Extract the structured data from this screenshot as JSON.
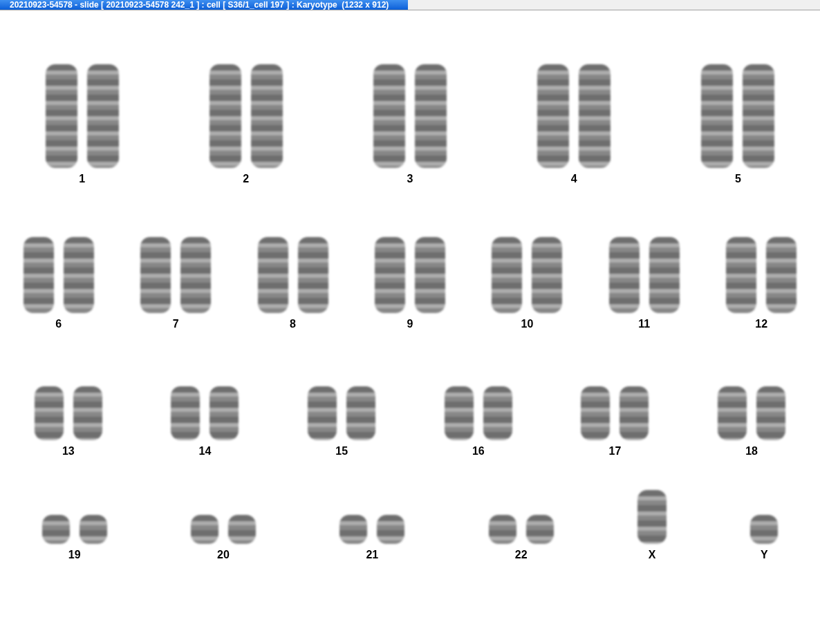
{
  "window": {
    "title": "20210923-54578 - slide [ 20210923-54578 242_1 ] : cell [ S36/1_cell 197 ] : Karyotype  (1232 x 912)"
  },
  "karyotype": {
    "rows": [
      {
        "items": [
          {
            "label": "1",
            "kind": "pair-large"
          },
          {
            "label": "2",
            "kind": "pair-large"
          },
          {
            "label": "3",
            "kind": "pair-large"
          },
          {
            "label": "4",
            "kind": "pair-large"
          },
          {
            "label": "5",
            "kind": "pair-large"
          }
        ]
      },
      {
        "items": [
          {
            "label": "6",
            "kind": "pair-medium"
          },
          {
            "label": "7",
            "kind": "pair-medium"
          },
          {
            "label": "8",
            "kind": "pair-medium"
          },
          {
            "label": "9",
            "kind": "pair-medium"
          },
          {
            "label": "10",
            "kind": "pair-medium"
          },
          {
            "label": "11",
            "kind": "pair-medium"
          },
          {
            "label": "12",
            "kind": "pair-medium"
          }
        ]
      },
      {
        "items": [
          {
            "label": "13",
            "kind": "pair-small"
          },
          {
            "label": "14",
            "kind": "pair-small"
          },
          {
            "label": "15",
            "kind": "pair-small"
          },
          {
            "label": "16",
            "kind": "pair-small"
          },
          {
            "label": "17",
            "kind": "pair-small"
          },
          {
            "label": "18",
            "kind": "pair-small"
          }
        ]
      },
      {
        "items": [
          {
            "label": "19",
            "kind": "pair-tiny"
          },
          {
            "label": "20",
            "kind": "pair-tiny"
          },
          {
            "label": "21",
            "kind": "pair-tiny"
          },
          {
            "label": "22",
            "kind": "pair-tiny"
          },
          {
            "label": "X",
            "kind": "single-small"
          },
          {
            "label": "Y",
            "kind": "single-tiny"
          }
        ]
      }
    ]
  }
}
